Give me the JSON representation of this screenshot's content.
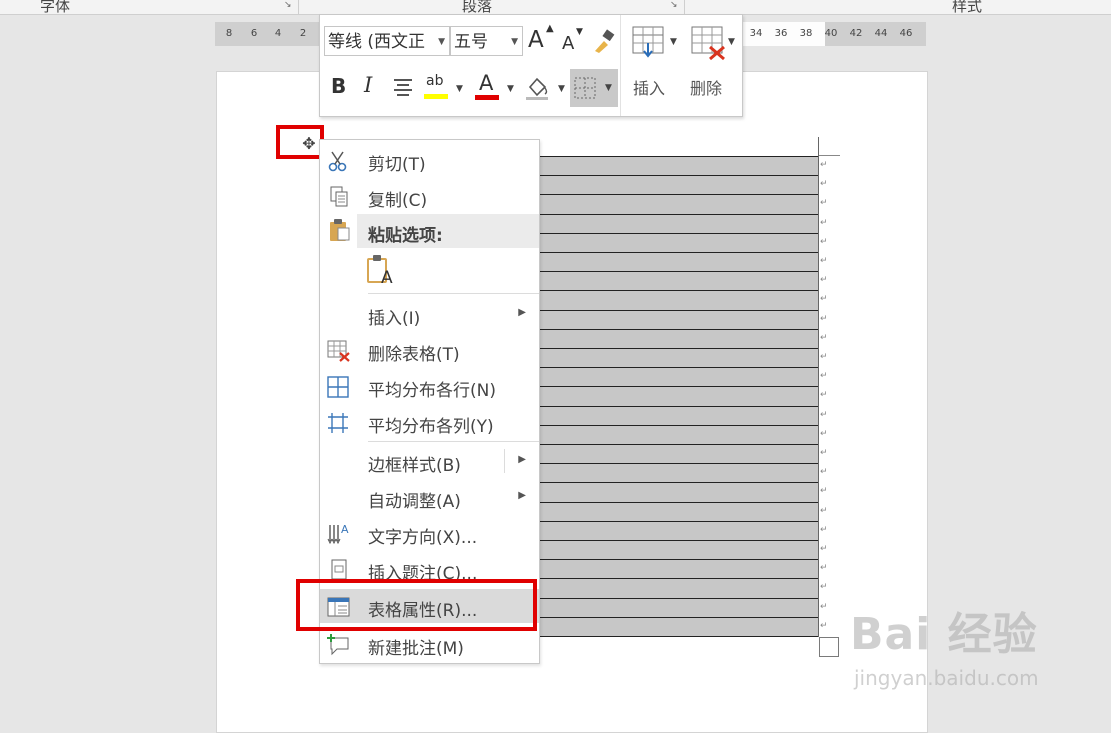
{
  "ribbon": {
    "groups": [
      {
        "label": "字体"
      },
      {
        "label": "段落"
      },
      {
        "label": "样式"
      }
    ],
    "launcher_glyph": "↘"
  },
  "ruler": {
    "left_ticks": [
      "8",
      "6",
      "4",
      "2"
    ],
    "right_ticks": [
      "34",
      "36",
      "38",
      "40",
      "42",
      "44",
      "46"
    ]
  },
  "mini_toolbar": {
    "font_name": "等线 (西文正",
    "font_size": "五号",
    "grow_font": "A",
    "shrink_font": "A",
    "bold": "B",
    "italic": "I",
    "highlight_text": "ab",
    "font_color_text": "A",
    "insert_label": "插入",
    "delete_label": "删除",
    "colors": {
      "highlight": "#ffff00",
      "font_color": "#e00000"
    }
  },
  "context_menu": {
    "items": [
      {
        "label": "剪切(T)",
        "icon": "scissors-icon"
      },
      {
        "label": "复制(C)",
        "icon": "copy-icon"
      },
      {
        "label": "粘贴选项:",
        "icon": "paste-icon"
      },
      {
        "label": "A",
        "icon": "paste-keep-text-icon"
      },
      {
        "label": "插入(I)",
        "submenu": true
      },
      {
        "label": "删除表格(T)",
        "icon": "delete-table-icon"
      },
      {
        "label": "平均分布各行(N)",
        "icon": "distribute-rows-icon"
      },
      {
        "label": "平均分布各列(Y)",
        "icon": "distribute-columns-icon"
      },
      {
        "label": "边框样式(B)",
        "submenu": true
      },
      {
        "label": "自动调整(A)",
        "submenu": true
      },
      {
        "label": "文字方向(X)...",
        "icon": "text-direction-icon"
      },
      {
        "label": "插入题注(C)...",
        "icon": "insert-caption-icon"
      },
      {
        "label": "表格属性(R)...",
        "icon": "table-properties-icon",
        "highlighted": true
      },
      {
        "label": "新建批注(M)",
        "icon": "new-comment-icon"
      }
    ]
  },
  "table": {
    "move_handle": "✥",
    "row_mark": "↵"
  },
  "watermark": {
    "main": "Bai 经验",
    "sub": "jingyan.baidu.com"
  },
  "colors": {
    "annotation_red": "#e00000",
    "selection_gray": "#c7c7c7"
  }
}
